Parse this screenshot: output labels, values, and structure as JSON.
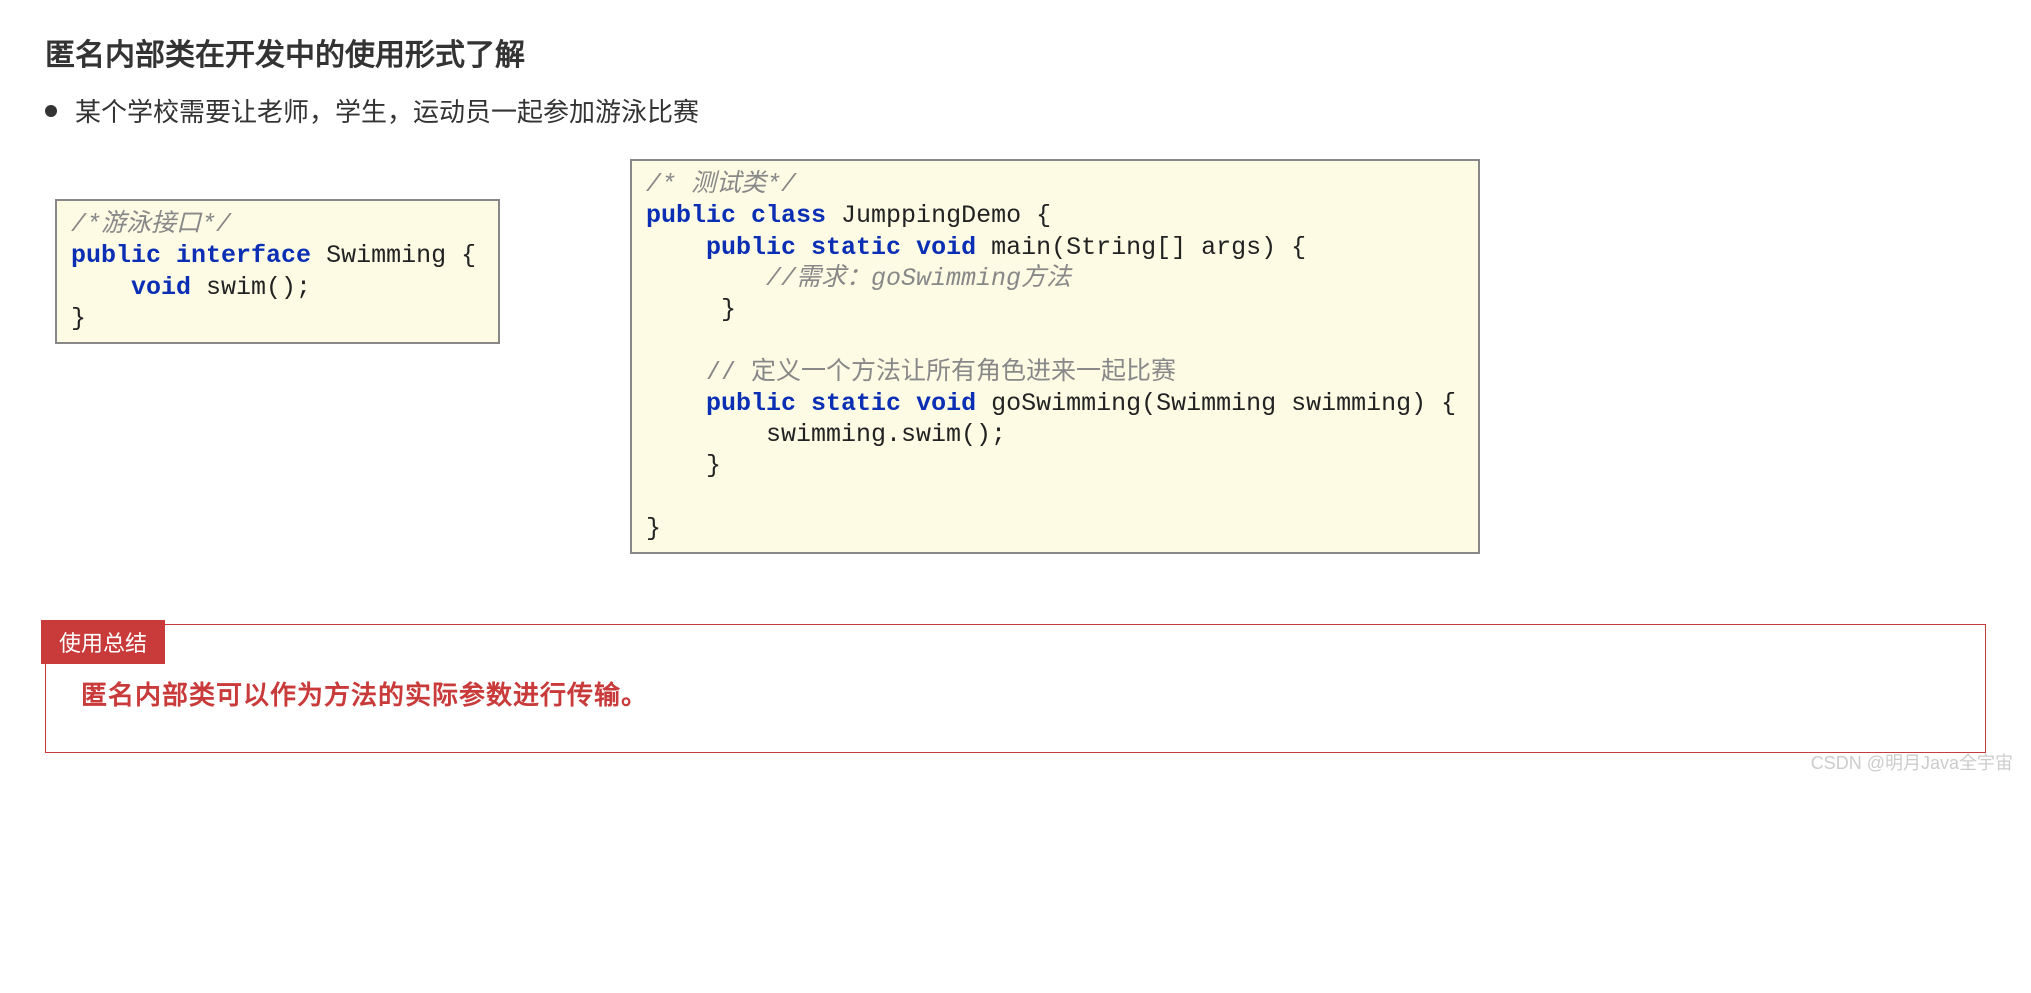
{
  "title": "匿名内部类在开发中的使用形式了解",
  "bullet": "某个学校需要让老师，学生，运动员一起参加游泳比赛",
  "code_left": {
    "c1": "/*游泳接口*/",
    "kw_public": "public",
    "kw_interface": "interface",
    "cls": " Swimming {",
    "kw_void": "void",
    "m1": " swim();",
    "end": "}"
  },
  "code_right": {
    "c1": "/* 测试类*/",
    "kw_public1": "public",
    "kw_class": "class",
    "cls": " JumppingDemo {",
    "kw_public2": "public",
    "kw_static1": "static",
    "kw_void1": "void",
    "main": " main(String[] args) {",
    "c2": "//需求：goSwimming方法",
    "brace1": "     }",
    "c3": "    // 定义一个方法让所有角色进来一起比赛",
    "kw_public3": "public",
    "kw_static2": "static",
    "kw_void2": "void",
    "gosig": " goSwimming(Swimming swimming) {",
    "body": "        swimming.swim();",
    "brace2": "    }",
    "end": "}"
  },
  "summary": {
    "tag": "使用总结",
    "text": "匿名内部类可以作为方法的实际参数进行传输。"
  },
  "watermark": "CSDN @明月Java全宇宙"
}
